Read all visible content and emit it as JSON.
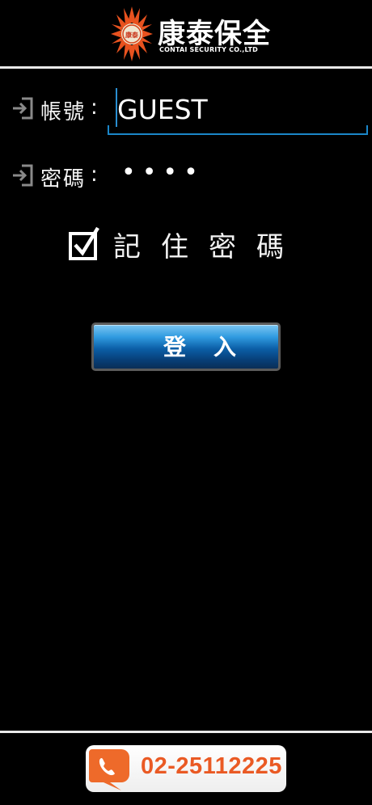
{
  "header": {
    "brand_zh": "康泰保全",
    "brand_en": "CONTAI SECURITY CO.,LTD",
    "logo_icon": "sun-logo-icon",
    "logo_mark": "康泰"
  },
  "form": {
    "account_label": "帳號",
    "account_value": "GUEST",
    "password_label": "密碼",
    "password_masked": "••••",
    "colon": ":",
    "remember_label": "記住密碼",
    "remember_checked": true,
    "login_label": "登入",
    "field_icon": "login-arrow-icon"
  },
  "footer": {
    "phone_icon": "phone-icon",
    "phone_number": "02-25112225"
  },
  "colors": {
    "background": "#000000",
    "accent_blue": "#1b87c9",
    "phone_orange": "#ea5a24"
  }
}
